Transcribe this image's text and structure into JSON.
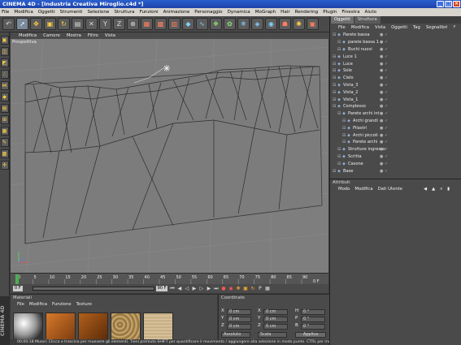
{
  "window": {
    "title": "CINEMA 4D - [Industria Creativa Miroglio.c4d *]"
  },
  "menu": [
    "File",
    "Modifica",
    "Oggetti",
    "Strumenti",
    "Selezione",
    "Struttura",
    "Funzioni",
    "Animazione",
    "Personaggio",
    "Dynamica",
    "MoGraph",
    "Hair",
    "Rendering",
    "Plugin",
    "Finestra",
    "Aiuto"
  ],
  "viewport": {
    "menu": [
      "Modifica",
      "Camere",
      "Mostra",
      "Filtro",
      "Vista"
    ],
    "label": "Prospettiva"
  },
  "timeline": {
    "ticks": [
      "0",
      "5",
      "10",
      "15",
      "20",
      "25",
      "30",
      "35",
      "40",
      "45",
      "50",
      "55",
      "60",
      "65",
      "70",
      "75",
      "80",
      "85",
      "90"
    ],
    "end_label": "0 F"
  },
  "playback": {
    "start": "0 F",
    "current": "90 F"
  },
  "materials": {
    "title": "Materiali",
    "menu": [
      "File",
      "Modifica",
      "Funzione",
      "Texture"
    ]
  },
  "coordinates": {
    "title": "Coordinate",
    "rows": [
      {
        "a": "X",
        "av": "0 cm",
        "b": "X",
        "bv": "0 cm",
        "c": "H",
        "cv": "0 °"
      },
      {
        "a": "Y",
        "av": "0 cm",
        "b": "Y",
        "bv": "0 cm",
        "c": "P",
        "cv": "0 °"
      },
      {
        "a": "Z",
        "av": "0 cm",
        "b": "Z",
        "bv": "0 cm",
        "c": "B",
        "cv": "0 °"
      }
    ],
    "mode1": "Assoluto",
    "mode2": "Scala",
    "apply": "Applica"
  },
  "objects": {
    "tabs": [
      "Oggetti",
      "Struttura"
    ],
    "menu": [
      "File",
      "Modifica",
      "Vista",
      "Oggetti",
      "Tag",
      "Segnalibri"
    ],
    "items": [
      {
        "label": "Parete bassa",
        "indent": 0
      },
      {
        "label": "parete bassa 1",
        "indent": 1
      },
      {
        "label": "Buchi nuovi",
        "indent": 1
      },
      {
        "label": "Luce 1",
        "indent": 0
      },
      {
        "label": "Luce",
        "indent": 0
      },
      {
        "label": "Sole",
        "indent": 0
      },
      {
        "label": "Cielo",
        "indent": 0
      },
      {
        "label": "Vista_3",
        "indent": 0
      },
      {
        "label": "Vista_2",
        "indent": 0
      },
      {
        "label": "Vista_1",
        "indent": 0
      },
      {
        "label": "Complesso",
        "indent": 0
      },
      {
        "label": "Parete archi int",
        "indent": 1
      },
      {
        "label": "Archi grandi",
        "indent": 2
      },
      {
        "label": "Pilastri",
        "indent": 2
      },
      {
        "label": "Archi piccoli",
        "indent": 2
      },
      {
        "label": "Parete archi",
        "indent": 2
      },
      {
        "label": "Strutture ingresso",
        "indent": 1
      },
      {
        "label": "Scritta",
        "indent": 1
      },
      {
        "label": "Casone",
        "indent": 1
      },
      {
        "label": "Base",
        "indent": 0
      }
    ]
  },
  "attributes": {
    "title": "Attributi",
    "menu": [
      "Modo",
      "Modifica",
      "Dati Utente"
    ]
  },
  "status": "00:00:18 Muovi: Clicca e trascina per muovere gli elementi. Tieni premuto SHIFT per quantificare il movimento / aggiungere alla selezione in modo punto. CTRL per muovere",
  "side_logo": "CINEMA 4D"
}
